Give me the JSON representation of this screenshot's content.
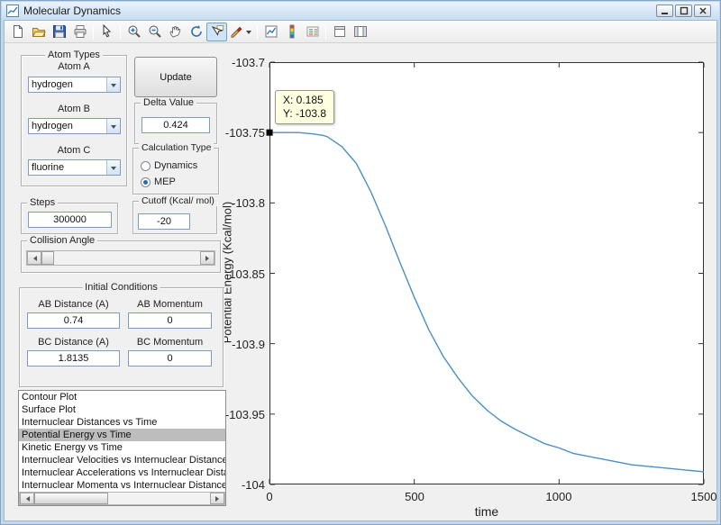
{
  "window": {
    "title": "Molecular Dynamics"
  },
  "toolbar": {
    "icons": [
      "new",
      "open",
      "save",
      "print",
      "edit-plot",
      "zoom-in",
      "zoom-out",
      "pan",
      "rotate-3d",
      "data-cursor",
      "brush",
      "link-plot",
      "insert-colorbar",
      "insert-legend",
      "hide-plot-tools",
      "show-plot-tools"
    ],
    "active_icon": "data-cursor"
  },
  "controls": {
    "atom_types": {
      "title": "Atom Types",
      "atom_a_label": "Atom A",
      "atom_a_value": "hydrogen",
      "atom_b_label": "Atom B",
      "atom_b_value": "hydrogen",
      "atom_c_label": "Atom C",
      "atom_c_value": "fluorine"
    },
    "update_button": "Update",
    "delta": {
      "title": "Delta Value",
      "value": "0.424"
    },
    "calculation_type": {
      "title": "Calculation Type",
      "options": [
        "Dynamics",
        "MEP"
      ],
      "selected": "MEP"
    },
    "steps": {
      "title": "Steps",
      "value": "300000"
    },
    "cutoff": {
      "title": "Cutoff (Kcal/ mol)",
      "value": "-20"
    },
    "collision_angle": {
      "title": "Collision Angle"
    },
    "initial_conditions": {
      "title": "Initial Conditions",
      "fields": [
        {
          "label": "AB Distance (A)",
          "value": "0.74"
        },
        {
          "label": "AB Momentum",
          "value": "0"
        },
        {
          "label": "BC Distance (A)",
          "value": "1.8135"
        },
        {
          "label": "BC Momentum",
          "value": "0"
        }
      ]
    },
    "plot_list": {
      "items": [
        "Contour Plot",
        "Surface Plot",
        "Internuclear Distances vs Time",
        "Potential Energy vs Time",
        "Kinetic Energy vs Time",
        "Internuclear Velocities vs Internuclear Distance",
        "Internuclear Accelerations vs Internuclear Distance",
        "Internuclear Momenta vs Internuclear Distance"
      ],
      "selected_index": 3
    }
  },
  "chart_data": {
    "type": "line",
    "title": "",
    "xlabel": "time",
    "ylabel": "Potential Energy (Kcal/mol)",
    "xlim": [
      0,
      1500
    ],
    "ylim": [
      -104,
      -103.7
    ],
    "xticks": [
      0,
      500,
      1000,
      1500
    ],
    "yticks": [
      -103.7,
      -103.75,
      -103.8,
      -103.85,
      -103.9,
      -103.95,
      -104
    ],
    "xtick_labels": [
      "0",
      "500",
      "1000",
      "1500"
    ],
    "ytick_labels": [
      "-103.7",
      "-103.75",
      "-103.8",
      "-103.85",
      "-103.9",
      "-103.95",
      "-104"
    ],
    "grid": false,
    "legend": false,
    "line_color": "#4a90c8",
    "axis_color": "#333333",
    "series": [
      {
        "name": "Potential Energy vs Time",
        "x": [
          0,
          50,
          100,
          150,
          185,
          200,
          250,
          300,
          350,
          400,
          450,
          500,
          550,
          600,
          650,
          700,
          750,
          800,
          850,
          900,
          950,
          1000,
          1050,
          1100,
          1150,
          1200,
          1250,
          1300,
          1350,
          1400,
          1450,
          1500
        ],
        "y": [
          -103.75,
          -103.75,
          -103.75,
          -103.751,
          -103.752,
          -103.753,
          -103.76,
          -103.772,
          -103.792,
          -103.816,
          -103.842,
          -103.867,
          -103.89,
          -103.909,
          -103.924,
          -103.937,
          -103.947,
          -103.955,
          -103.961,
          -103.966,
          -103.971,
          -103.974,
          -103.978,
          -103.98,
          -103.982,
          -103.984,
          -103.986,
          -103.987,
          -103.988,
          -103.989,
          -103.99,
          -103.991
        ]
      }
    ],
    "datatip": {
      "x_text": "X: 0.185",
      "y_text": "Y: -103.8",
      "x": 0.185,
      "y": -103.75
    }
  }
}
